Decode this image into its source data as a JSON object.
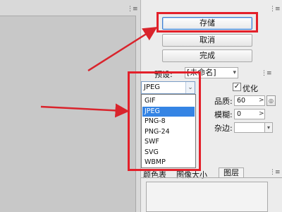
{
  "actions": {
    "save_label": "存储",
    "cancel_label": "取消",
    "done_label": "完成"
  },
  "preset": {
    "label": "预设:",
    "value": "[未命名]"
  },
  "format": {
    "selected": "JPEG",
    "options": [
      "GIF",
      "JPEG",
      "PNG-8",
      "PNG-24",
      "SWF",
      "SVG",
      "WBMP"
    ]
  },
  "settings": {
    "optimize_label": "优化",
    "quality_label": "品质:",
    "quality_value": "60",
    "blur_label": "模糊:",
    "blur_value": "0",
    "matte_label": "杂边:"
  },
  "tabs": [
    {
      "label": "颜色表"
    },
    {
      "label": "图像大小"
    },
    {
      "label": "图层"
    }
  ],
  "colors": {
    "highlight_red": "#e3202a",
    "selection_blue": "#3584e4",
    "arrow_red": "#d9242c"
  },
  "icons": [
    "panel-grip-icon",
    "chevron-down-icon",
    "checkbox-checked-icon",
    "arrow-right-icon",
    "annotation-arrow-icon"
  ]
}
